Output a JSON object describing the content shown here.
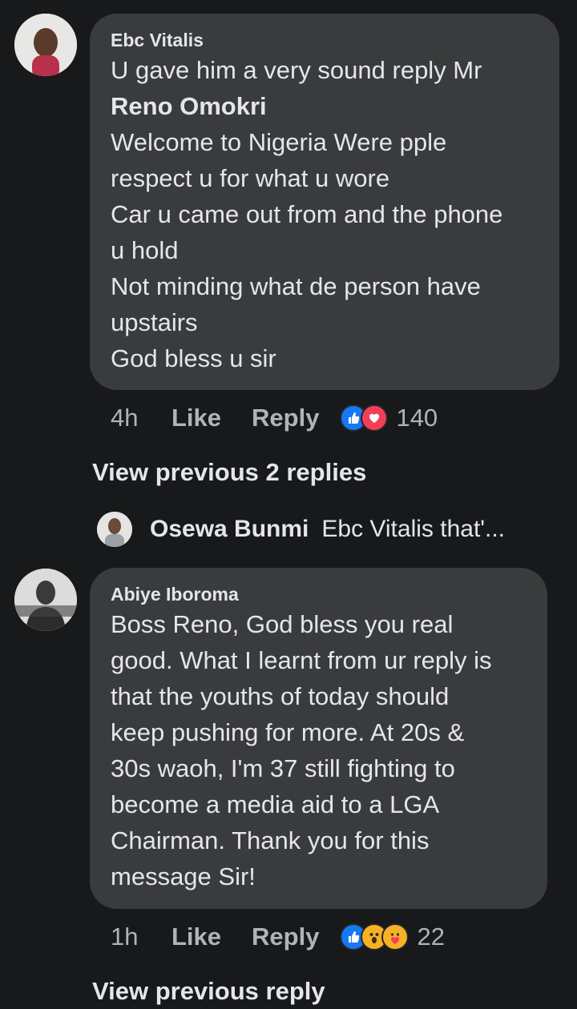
{
  "comments": [
    {
      "author": "Ebc Vitalis",
      "lines": [
        {
          "text": "U gave him a very sound reply Mr",
          "bold": false
        },
        {
          "text": "Reno Omokri",
          "bold": true
        },
        {
          "text": "Welcome to Nigeria Were pple",
          "bold": false
        },
        {
          "text": "respect u for what u wore",
          "bold": false
        },
        {
          "text": "Car u came out from and the phone",
          "bold": false
        },
        {
          "text": "u hold",
          "bold": false
        },
        {
          "text": "Not minding what de person have",
          "bold": false
        },
        {
          "text": "upstairs",
          "bold": false
        },
        {
          "text": "God bless u sir",
          "bold": false
        }
      ],
      "time": "4h",
      "like_label": "Like",
      "reply_label": "Reply",
      "reactions": [
        "like-icon",
        "love-icon"
      ],
      "reaction_count": "140"
    },
    {
      "author": "Abiye Iboroma",
      "lines": [
        {
          "text": "Boss Reno, God bless you real",
          "bold": false
        },
        {
          "text": "good. What I learnt from ur reply is",
          "bold": false
        },
        {
          "text": "that the youths of today should",
          "bold": false
        },
        {
          "text": "keep pushing for more. At 20s &",
          "bold": false
        },
        {
          "text": "30s waoh, I'm 37 still fighting to",
          "bold": false
        },
        {
          "text": "become a media aid to a LGA",
          "bold": false
        },
        {
          "text": "Chairman. Thank you for this",
          "bold": false
        },
        {
          "text": "message Sir!",
          "bold": false
        }
      ],
      "time": "1h",
      "like_label": "Like",
      "reply_label": "Reply",
      "reactions": [
        "like-icon",
        "wow-icon",
        "care-icon"
      ],
      "reaction_count": "22"
    }
  ],
  "view_previous_replies_1": "View previous 2 replies",
  "reply_preview": {
    "author": "Osewa Bunmi",
    "text": "Ebc Vitalis that'..."
  },
  "view_previous_replies_2": "View previous reply",
  "colors": {
    "background": "#18191a",
    "bubble": "#3a3b3c",
    "text": "#e4e6eb",
    "secondary": "#b0b3b8",
    "like_blue": "#1877f2",
    "love_red": "#f33e58",
    "wow_yellow": "#f7b125"
  }
}
